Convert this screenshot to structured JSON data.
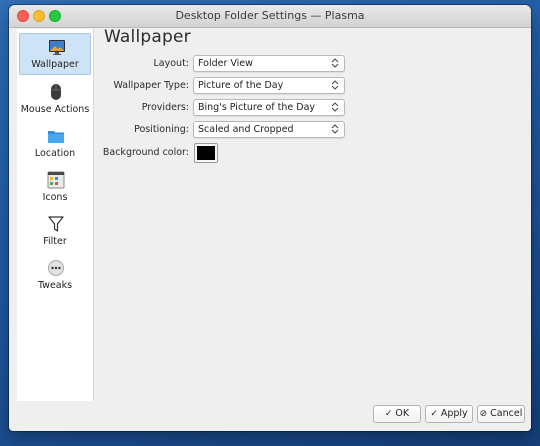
{
  "window": {
    "title": "Desktop Folder Settings — Plasma"
  },
  "sidebar": {
    "items": [
      {
        "label": "Wallpaper",
        "icon": "wallpaper-icon",
        "active": true
      },
      {
        "label": "Mouse Actions",
        "icon": "mouse-icon",
        "active": false
      },
      {
        "label": "Location",
        "icon": "folder-icon",
        "active": false
      },
      {
        "label": "Icons",
        "icon": "icons-grid-icon",
        "active": false
      },
      {
        "label": "Filter",
        "icon": "filter-icon",
        "active": false
      },
      {
        "label": "Tweaks",
        "icon": "tweaks-icon",
        "active": false
      }
    ]
  },
  "main": {
    "title": "Wallpaper",
    "fields": {
      "layout": {
        "label": "Layout:",
        "value": "Folder View"
      },
      "wallpaper_type": {
        "label": "Wallpaper Type:",
        "value": "Picture of the Day"
      },
      "providers": {
        "label": "Providers:",
        "value": "Bing's Picture of the Day"
      },
      "positioning": {
        "label": "Positioning:",
        "value": "Scaled and Cropped"
      },
      "background_color": {
        "label": "Background color:",
        "value": "#000000"
      }
    }
  },
  "buttons": {
    "ok": "OK",
    "apply": "Apply",
    "cancel": "Cancel"
  },
  "colors": {
    "active_item": "#cfe3f6",
    "background_swatch": "#000000"
  }
}
